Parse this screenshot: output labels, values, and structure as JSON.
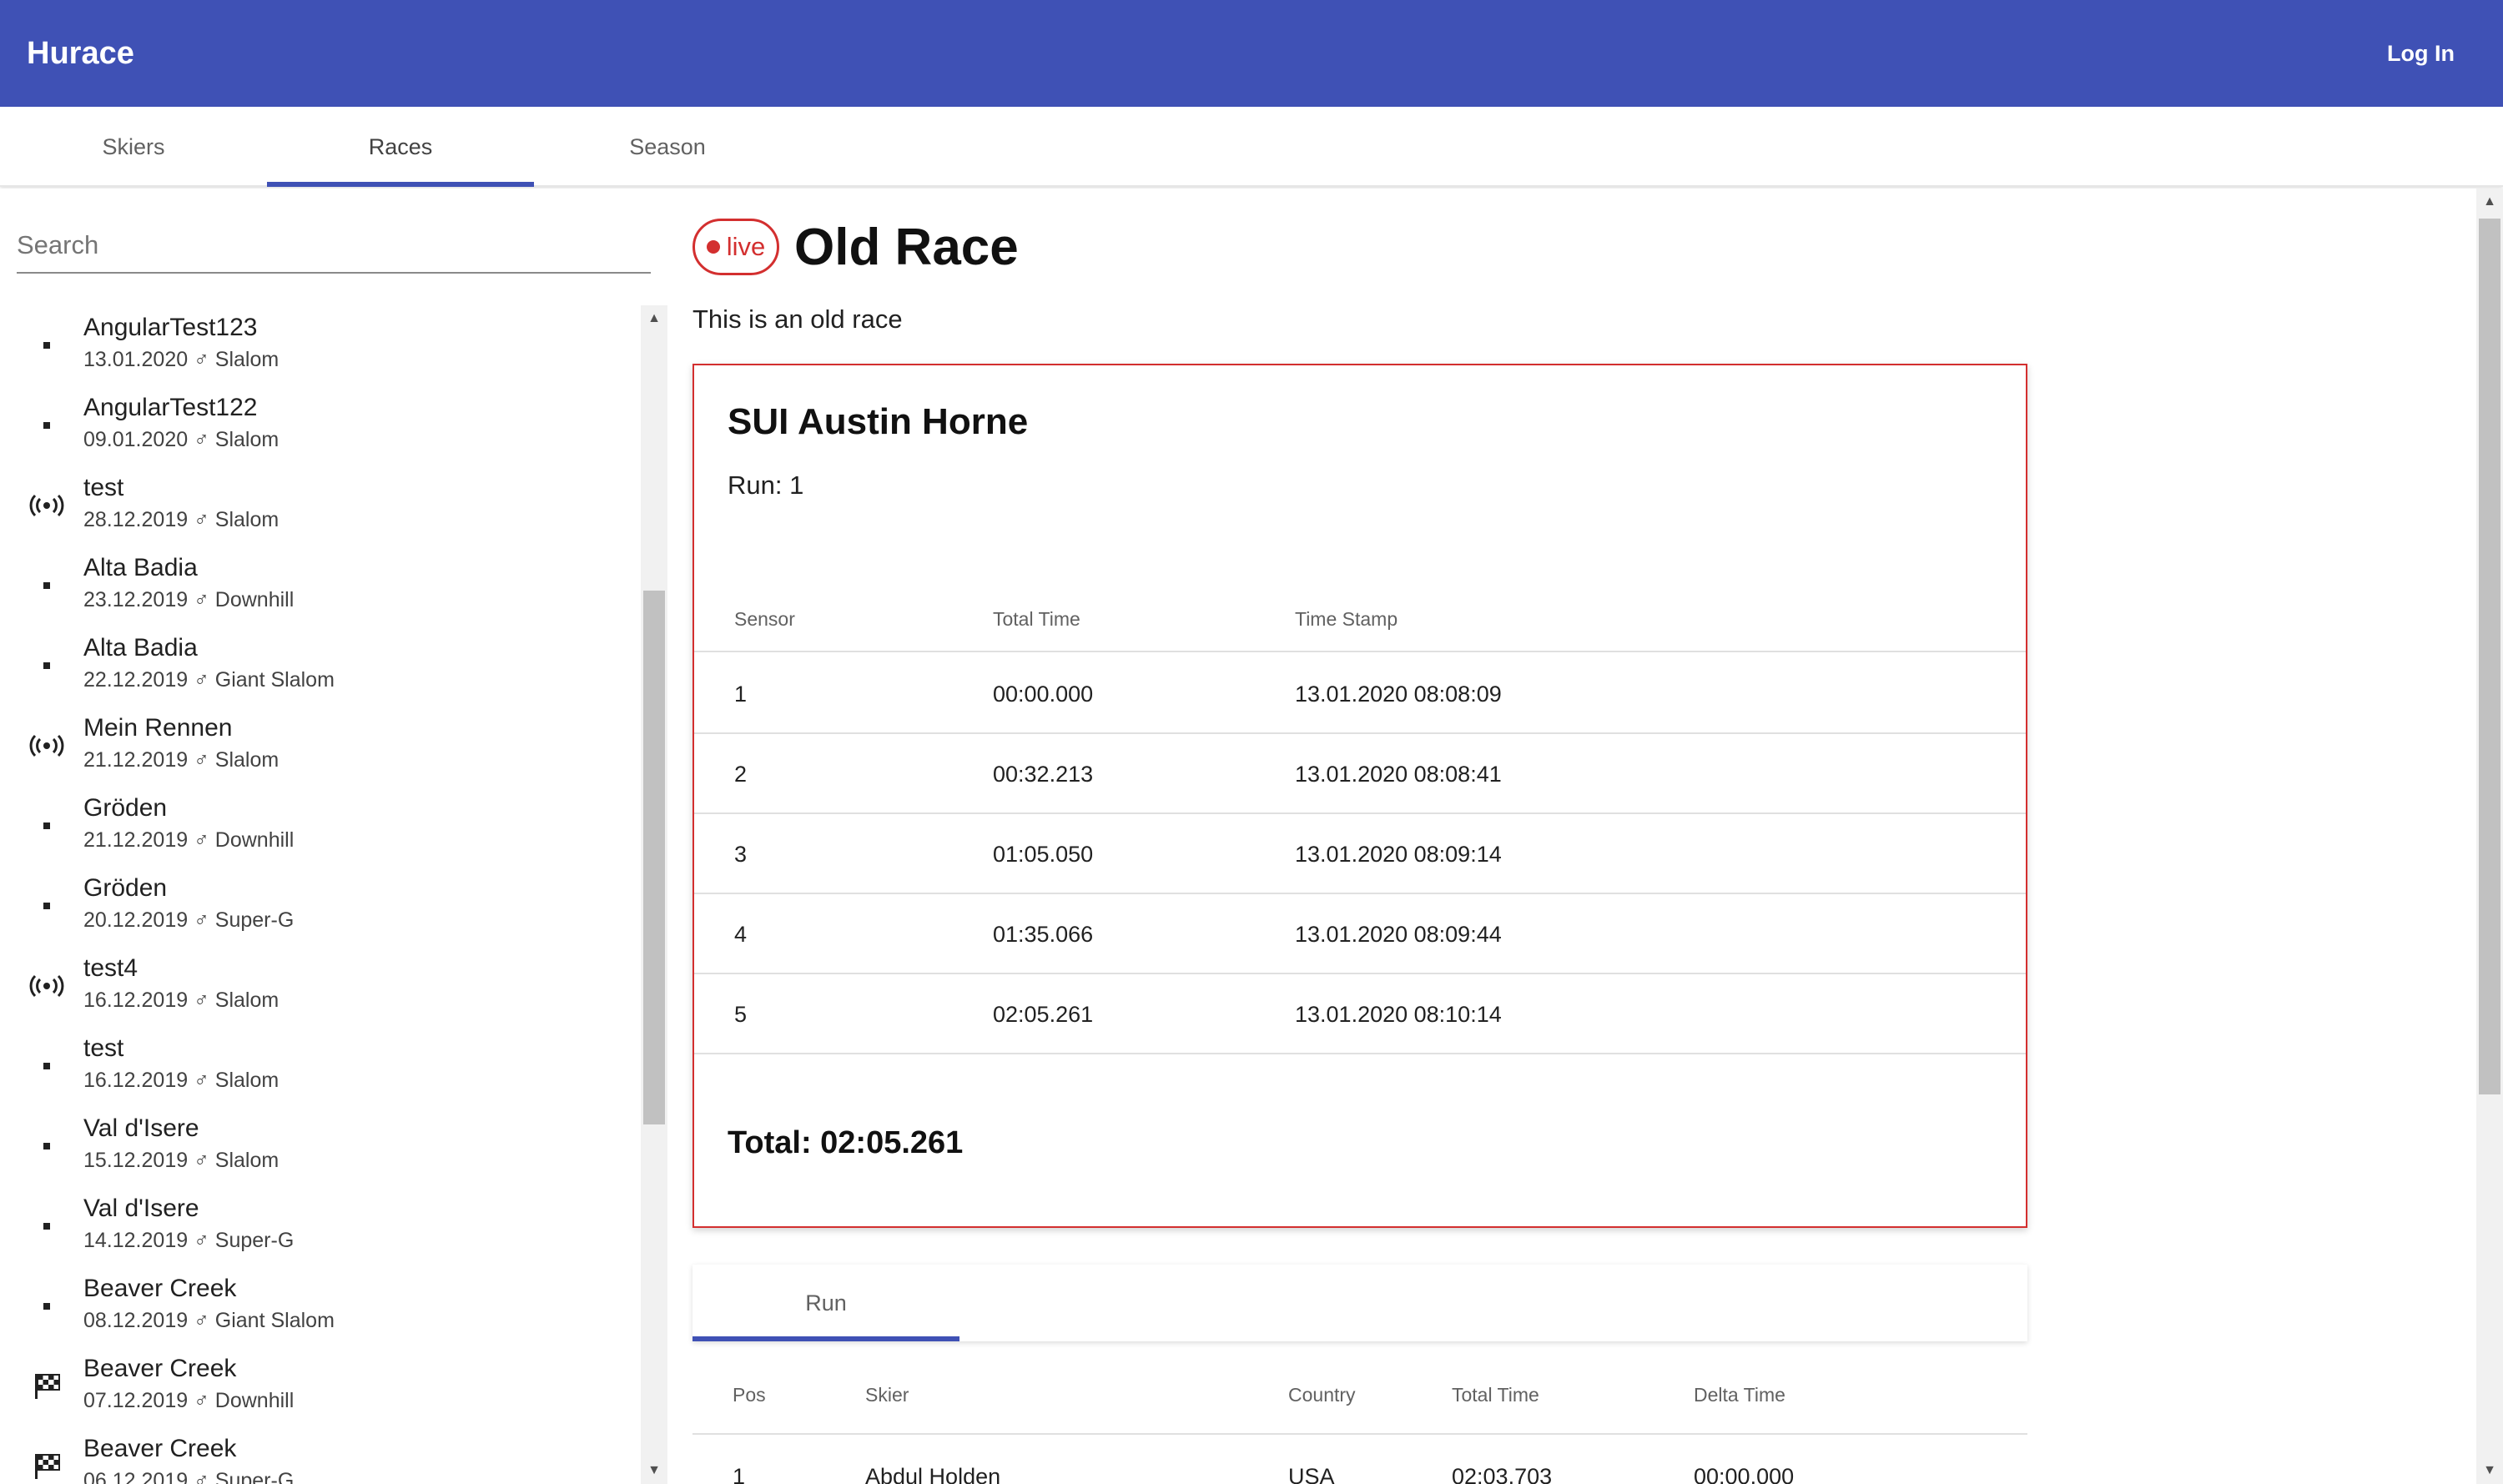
{
  "app": {
    "title": "Hurace",
    "login_label": "Log In"
  },
  "main_tabs": [
    {
      "label": "Skiers"
    },
    {
      "label": "Races",
      "active": true
    },
    {
      "label": "Season"
    }
  ],
  "sidebar": {
    "search_placeholder": "Search",
    "races": [
      {
        "name": "AngularTest123",
        "date": "13.01.2020",
        "discipline": "Slalom",
        "status": "dot"
      },
      {
        "name": "AngularTest122",
        "date": "09.01.2020",
        "discipline": "Slalom",
        "status": "dot"
      },
      {
        "name": "test",
        "date": "28.12.2019",
        "discipline": "Slalom",
        "status": "live"
      },
      {
        "name": "Alta Badia",
        "date": "23.12.2019",
        "discipline": "Downhill",
        "status": "dot"
      },
      {
        "name": "Alta Badia",
        "date": "22.12.2019",
        "discipline": "Giant Slalom",
        "status": "dot"
      },
      {
        "name": "Mein Rennen",
        "date": "21.12.2019",
        "discipline": "Slalom",
        "status": "live"
      },
      {
        "name": "Gröden",
        "date": "21.12.2019",
        "discipline": "Downhill",
        "status": "dot"
      },
      {
        "name": "Gröden",
        "date": "20.12.2019",
        "discipline": "Super-G",
        "status": "dot"
      },
      {
        "name": "test4",
        "date": "16.12.2019",
        "discipline": "Slalom",
        "status": "live"
      },
      {
        "name": "test",
        "date": "16.12.2019",
        "discipline": "Slalom",
        "status": "dot"
      },
      {
        "name": "Val d'Isere",
        "date": "15.12.2019",
        "discipline": "Slalom",
        "status": "dot"
      },
      {
        "name": "Val d'Isere",
        "date": "14.12.2019",
        "discipline": "Super-G",
        "status": "dot"
      },
      {
        "name": "Beaver Creek",
        "date": "08.12.2019",
        "discipline": "Giant Slalom",
        "status": "dot"
      },
      {
        "name": "Beaver Creek",
        "date": "07.12.2019",
        "discipline": "Downhill",
        "status": "finished"
      },
      {
        "name": "Beaver Creek",
        "date": "06.12.2019",
        "discipline": "Super-G",
        "status": "finished"
      }
    ],
    "gender_symbol": "♂",
    "icons": {
      "dot": "square-dot-icon",
      "live": "broadcast-icon",
      "finished": "checkered-flag-icon"
    }
  },
  "race": {
    "live_label": "live",
    "title": "Old Race",
    "description": "This is an old race",
    "current_skier": {
      "name": "SUI Austin Horne",
      "run_label": "Run: 1",
      "columns": [
        "Sensor",
        "Total Time",
        "Time Stamp"
      ],
      "rows": [
        [
          "1",
          "00:00.000",
          "13.01.2020 08:08:09"
        ],
        [
          "2",
          "00:32.213",
          "13.01.2020 08:08:41"
        ],
        [
          "3",
          "01:05.050",
          "13.01.2020 08:09:14"
        ],
        [
          "4",
          "01:35.066",
          "13.01.2020 08:09:44"
        ],
        [
          "5",
          "02:05.261",
          "13.01.2020 08:10:14"
        ]
      ],
      "total_label": "Total: 02:05.261"
    },
    "run_tabs": [
      {
        "label": "Run"
      }
    ],
    "results": {
      "columns": [
        "Pos",
        "Skier",
        "Country",
        "Total Time",
        "Delta Time"
      ],
      "rows": [
        [
          "1",
          "Abdul Holden",
          "USA",
          "02:03.703",
          "00:00.000"
        ]
      ]
    }
  },
  "colors": {
    "primary": "#3f51b5",
    "live": "#d32f2f"
  }
}
